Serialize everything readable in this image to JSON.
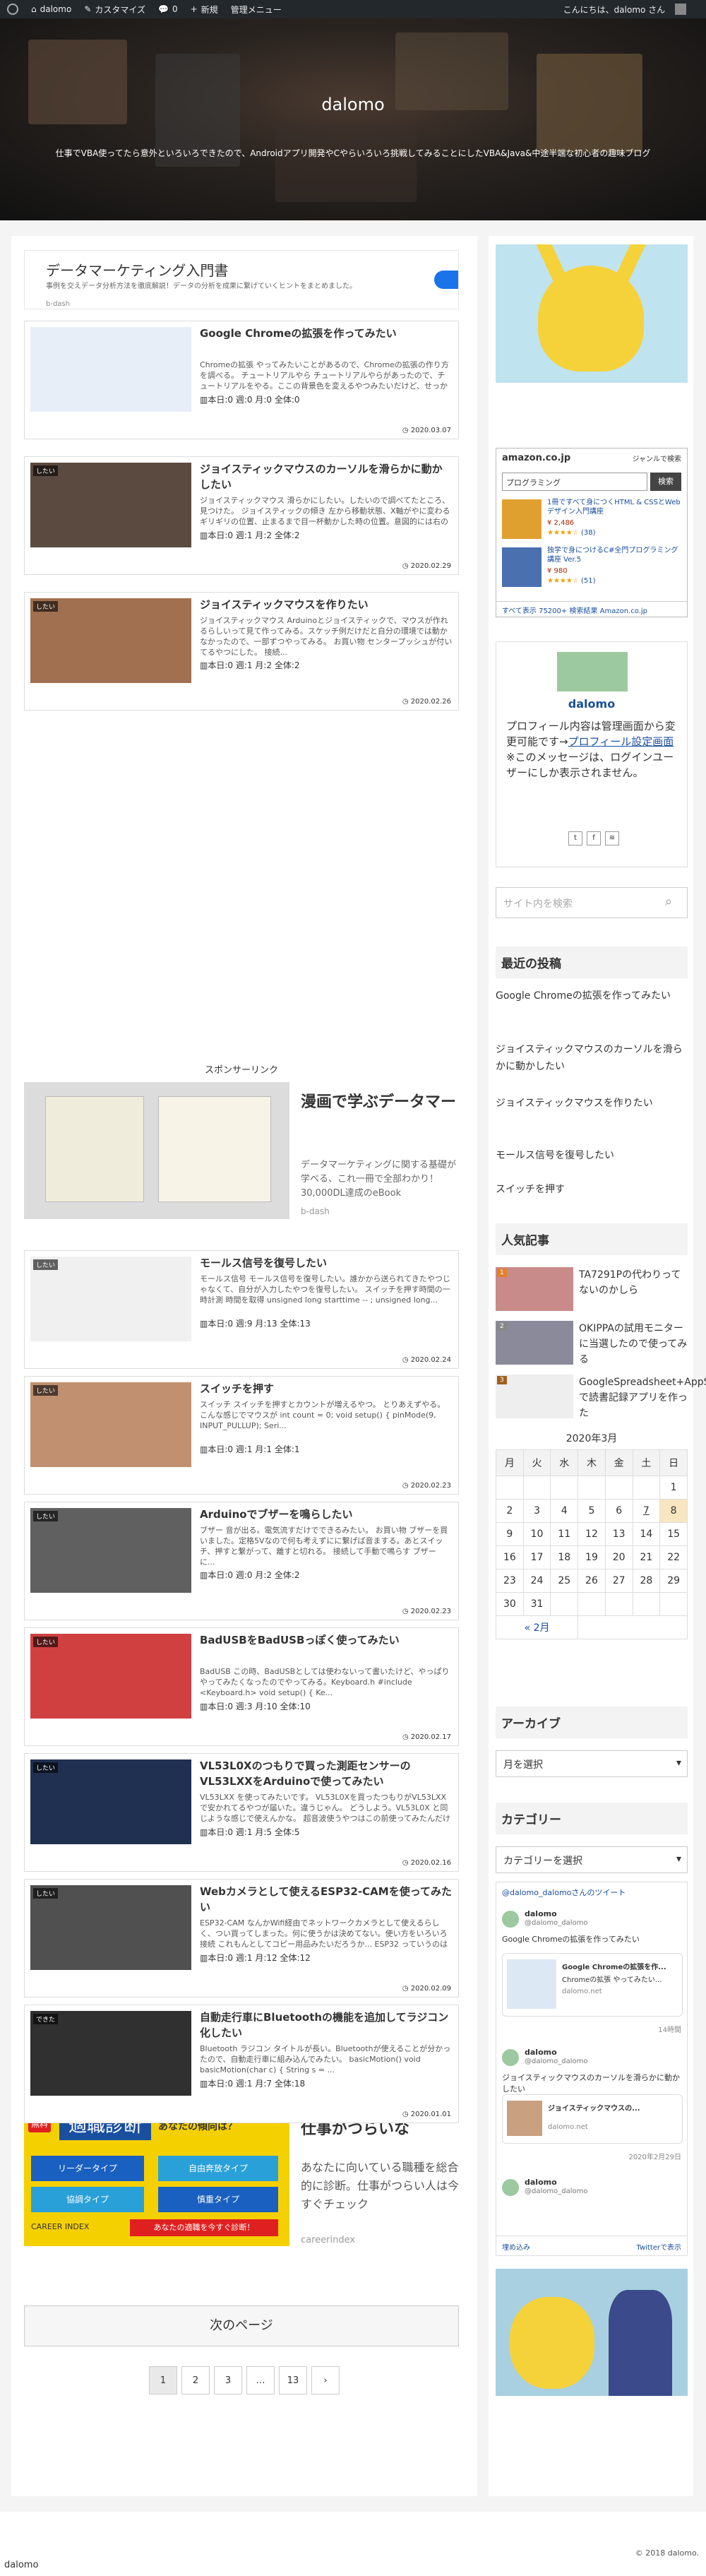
{
  "adminbar": {
    "site": "dalomo",
    "customize": "カスタマイズ",
    "comments": "0",
    "new": "新規",
    "admin": "管理メニュー",
    "greeting": "こんにちは、dalomo さん"
  },
  "header": {
    "title": "dalomo",
    "tagline": "仕事でVBA使ってたら意外といろいろできたので、Androidアプリ開発やCやらいろいろ挑戦してみることにしたVBA&Java&中途半端な初心者の趣味ブログ"
  },
  "ad_top": {
    "title": "データマーケティング入門書",
    "desc": "事例を交えデータ分析方法を徹底解説！データの分析を成果に繋げていくヒントをまとめました。",
    "source": "b-dash"
  },
  "posts": [
    {
      "title": "Google Chromeの拡張を作ってみたい",
      "excerpt": "Chromeの拡張 やってみたいことがあるので、Chromeの拡張の作り方を調べる。 チュートリアルやら チュートリアルやらがあったので、チュートリアルをやる。ここの背景色を変えるやつみたいだけど、せっかくなのでこのブログの色を変え...",
      "stats": "本日:0 週:0 月:0 全体:0",
      "date": "2020.03.07",
      "tag": ""
    },
    {
      "title": "ジョイスティックマウスのカーソルを滑らかに動かしたい",
      "excerpt": "ジョイスティックマウス 滑らかにしたい。したいので調べてたところ、見つけた。 ジョイスティックの傾き 左から移動状態、X軸がやに変わるギリギリの位置、止まるまで目一杯動かした時の位置。意図的には右の位置でやに変わってるように思うけ...",
      "stats": "本日:0 週:1 月:2 全体:2",
      "date": "2020.02.29",
      "tag": "したい"
    },
    {
      "title": "ジョイスティックマウスを作りたい",
      "excerpt": "ジョイスティックマウス Arduinoとジョイスティックで、マウスが作れるらしいって見て作ってみる。スケッチ例だけだと自分の環境では動かなかったので、一部ずつやってみる。 お買い物 センタープッシュが付いてるやつにした。 接続...",
      "stats": "本日:0 週:1 月:2 全体:2",
      "date": "2020.02.26",
      "tag": "したい"
    },
    {
      "title": "モールス信号を復号したい",
      "excerpt": "モールス信号 モールス信号を復号したい。誰かから送られてきたやつじゃなくて、自分が入力したやつを復号したい。 スイッチを押す時間の一時計測 時間を取得 unsigned long starttime -- ; unsigned long...",
      "stats": "本日:0 週:9 月:13 全体:13",
      "date": "2020.02.24",
      "tag": "したい"
    },
    {
      "title": "スイッチを押す",
      "excerpt": "スイッチ スイッチを押すとカウントが増えるやつ。 とりあえずやる。こんな感じでマウスが int count = 0; void setup() { pinMode(9, INPUT_PULLUP); Seri...",
      "stats": "本日:0 週:1 月:1 全体:1",
      "date": "2020.02.23",
      "tag": "したい"
    },
    {
      "title": "Arduinoでブザーを鳴らしたい",
      "excerpt": "ブザー 音が出る。電気流すだけでできるみたい。 お買い物 ブザーを買いました。定格5Vなので何も考えずにに繋げば音まする。あとスイッチ、押すと繋がって、離すと切れる。 接続して手動で鳴らす ブザー に...",
      "stats": "本日:0 週:0 月:2 全体:2",
      "date": "2020.02.23",
      "tag": "したい"
    },
    {
      "title": "BadUSBをBadUSBっぽく使ってみたい",
      "excerpt": "BadUSB この時、BadUSBとしては使わないって書いたけど、やっぱりやってみたくなったのでやってみる。Keyboard.h #include <Keyboard.h> void setup() { Ke...",
      "stats": "本日:0 週:3 月:10 全体:10",
      "date": "2020.02.17",
      "tag": "したい"
    },
    {
      "title": "VL53L0Xのつもりで買った測距センサーのVL53LXXをArduinoで使ってみたい",
      "excerpt": "VL53LXX を使ってみたいです。 VL53L0Xを買ったつもりがVL53LXXで安かれてるやつが届いた。違うじゃん。 どうしよう。VL53L0X と同じような感じで使えんかな。 超音波使うやつはこの前使ってみたんだけどな...",
      "stats": "本日:0 週:1 月:5 全体:5",
      "date": "2020.02.16",
      "tag": "したい"
    },
    {
      "title": "Webカメラとして使えるESP32-CAMを使ってみたい",
      "excerpt": "ESP32-CAM なんかWifi経由でネットワークカメラとして使えるらしく、つい買ってしまった。何に使うかは決めてない。使い方をいろいろ 接続 これもんとしてコピー用品みたいだろうか... ESP32 っていうのはマイ...",
      "stats": "本日:0 週:1 月:12 全体:12",
      "date": "2020.02.09",
      "tag": "したい"
    },
    {
      "title": "自動走行車にBluetoothの機能を追加してラジコン化したい",
      "excerpt": "Bluetooth ラジコン タイトルが長い。Bluetoothが使えることが分かったので、自動走行車に組み込んでみたい。 basicMotion() void basicMotion(char c) { String s = ...",
      "stats": "本日:0 週:1 月:7 全体:18",
      "date": "2020.01.01",
      "tag": "できた"
    }
  ],
  "sponsor_label": "スポンサーリンク",
  "ad_mid": {
    "title": "漫画で学ぶデータマー",
    "desc": "データマーケティングに関する基礎が学べる、これ一冊で全部わかり！30,000DL達成のeBook",
    "source": "b-dash"
  },
  "ad_bottom": {
    "title": "仕事がつらいな",
    "desc": "あなたに向いている職種を総合的に診断。仕事がつらい人は今すぐチェック",
    "source": "careerindex",
    "banner": "適職診断",
    "banner_sub": "あなたの傾向は？",
    "cells": [
      "リーダータイプ",
      "自由奔放タイプ",
      "協調タイプ",
      "慎重タイプ"
    ],
    "foot": "CAREER INDEX",
    "foot2": "あなたの適職を今すぐ診断！",
    "free": "無料"
  },
  "next_page": "次のページ",
  "pager": [
    "1",
    "2",
    "3",
    "…",
    "13",
    "›"
  ],
  "sidebar": {
    "amazon": {
      "logo": "amazon.co.jp",
      "genre": "ジャンルで検索",
      "query": "プログラミング",
      "search": "検索",
      "item1": "1冊ですべて身につくHTML & CSSとWebデザイン入門講座",
      "price1": "¥ 2,486",
      "rating1": "(38)",
      "item2": "独学で身につけるC#全門プログラミング講座 Ver.5",
      "price2": "¥ 980",
      "rating2": "(51)",
      "more": "すべて表示 75200+ 検索結果 Amazon.co.jp"
    },
    "profile": {
      "name": "dalomo",
      "text1": "プロフィール内容は管理画面から変更可能です→",
      "link": "プロフィール設定画面",
      "text2": "※このメッセージは、ログインユーザーにしか表示されません。"
    },
    "search_placeholder": "サイト内を検索",
    "recent_title": "最近の投稿",
    "recent": [
      "Google Chromeの拡張を作ってみたい",
      "ジョイスティックマウスのカーソルを滑らかに動かしたい",
      "ジョイスティックマウスを作りたい",
      "モールス信号を復号したい",
      "スイッチを押す"
    ],
    "popular_title": "人気記事",
    "popular": [
      {
        "rank": "1",
        "title": "TA7291Pの代わりってないのかしら"
      },
      {
        "rank": "2",
        "title": "OKIPPAの試用モニターに当選したので使ってみる"
      },
      {
        "rank": "3",
        "title": "GoogleSpreadsheet+AppSheetで読書記録アプリを作った"
      }
    ],
    "calendar": {
      "title": "2020年3月",
      "days": [
        "月",
        "火",
        "水",
        "木",
        "金",
        "土",
        "日"
      ],
      "rows": [
        [
          "",
          "",
          "",
          "",
          "",
          "",
          "1"
        ],
        [
          "2",
          "3",
          "4",
          "5",
          "6",
          "7",
          "8"
        ],
        [
          "9",
          "10",
          "11",
          "12",
          "13",
          "14",
          "15"
        ],
        [
          "16",
          "17",
          "18",
          "19",
          "20",
          "21",
          "22"
        ],
        [
          "23",
          "24",
          "25",
          "26",
          "27",
          "28",
          "29"
        ],
        [
          "30",
          "31",
          "",
          "",
          "",
          "",
          ""
        ]
      ],
      "prev": "« 2月"
    },
    "archive_title": "アーカイブ",
    "archive_select": "月を選択",
    "category_title": "カテゴリー",
    "category_select": "カテゴリーを選択",
    "twitter": {
      "header": "@dalomo_dalomoさんのツイート",
      "user": "dalomo",
      "handle": "@dalomo_dalomo",
      "tweet1": "Google Chromeの拡張を作ってみたい",
      "card1": "Google Chromeの拡張を作...",
      "card1sub": "Chromeの拡張 やってみたい...",
      "card1src": "dalomo.net",
      "time1": "14時間",
      "tweet2": "ジョイスティックマウスのカーソルを滑らかに動かしたい",
      "card2": "ジョイスティックマウスの...",
      "card2src": "dalomo.net",
      "time2": "2020年2月29日",
      "embed": "埋め込み",
      "view": "Twitterで表示"
    }
  },
  "footer": {
    "left": "dalomo",
    "copy": "© 2018 dalomo."
  }
}
